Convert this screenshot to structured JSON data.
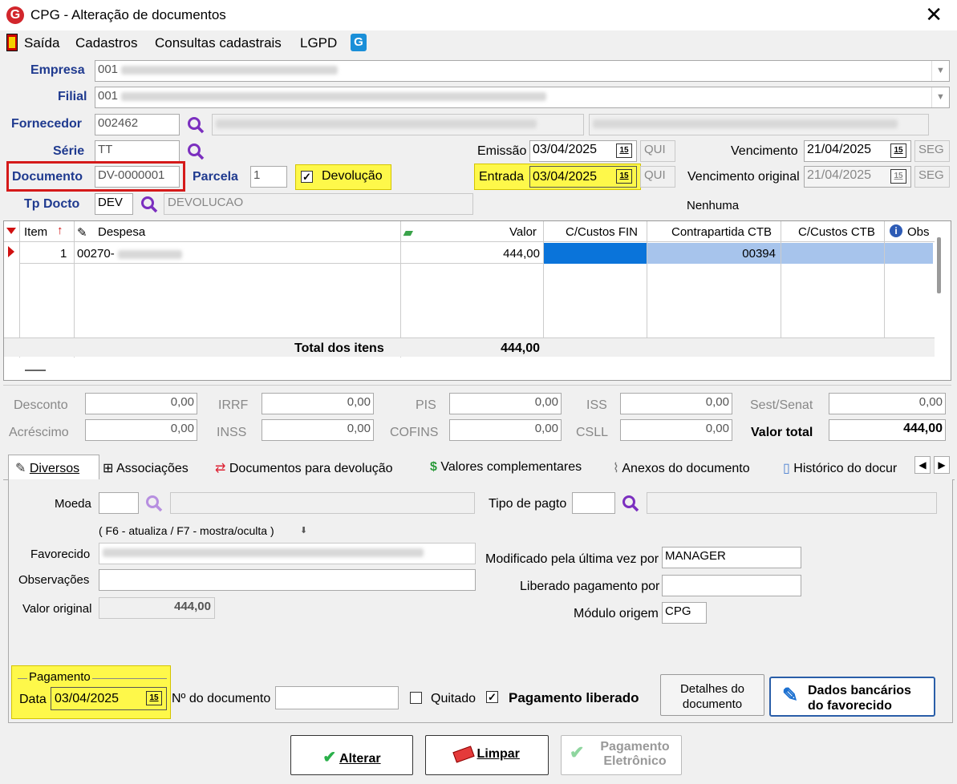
{
  "window": {
    "title": "CPG - Alteração de documentos",
    "logo": "G"
  },
  "menu": [
    "Saída",
    "Cadastros",
    "Consultas cadastrais",
    "LGPD"
  ],
  "form": {
    "empresa_label": "Empresa",
    "empresa_code": "001",
    "filial_label": "Filial",
    "filial_code": "001",
    "fornecedor_label": "Fornecedor",
    "fornecedor_code": "002462",
    "serie_label": "Série",
    "serie_value": "TT",
    "documento_label": "Documento",
    "documento_value": "DV-0000001",
    "parcela_label": "Parcela",
    "parcela_value": "1",
    "devolucao_label": "Devolução",
    "tpdocto_label": "Tp Docto",
    "tpdocto_code": "DEV",
    "tpdocto_desc": "DEVOLUCAO",
    "emissao_label": "Emissão",
    "emissao_value": "03/04/2025",
    "emissao_day": "QUI",
    "entrada_label": "Entrada",
    "entrada_value": "03/04/2025",
    "entrada_day": "QUI",
    "vencimento_label": "Vencimento",
    "vencimento_value": "21/04/2025",
    "vencimento_day": "SEG",
    "venc_orig_label": "Vencimento original",
    "venc_orig_value": "21/04/2025",
    "venc_orig_day": "SEG",
    "nenhuma": "Nenhuma",
    "cal_glyph": "15"
  },
  "grid": {
    "headers": {
      "item": "Item",
      "despesa": "Despesa",
      "valor": "Valor",
      "ccfin": "C/Custos FIN",
      "contra": "Contrapartida CTB",
      "ccctb": "C/Custos CTB",
      "obs": "Obs"
    },
    "row": {
      "item": "1",
      "despesa": "00270-",
      "valor": "444,00",
      "contra": "00394"
    },
    "total_label": "Total dos itens",
    "total_value": "444,00"
  },
  "taxes": {
    "desconto_label": "Desconto",
    "desconto": "0,00",
    "acrescimo_label": "Acréscimo",
    "acrescimo": "0,00",
    "irrf_label": "IRRF",
    "irrf": "0,00",
    "inss_label": "INSS",
    "inss": "0,00",
    "pis_label": "PIS",
    "pis": "0,00",
    "cofins_label": "COFINS",
    "cofins": "0,00",
    "iss_label": "ISS",
    "iss": "0,00",
    "csll_label": "CSLL",
    "csll": "0,00",
    "sest_label": "Sest/Senat",
    "sest": "0,00",
    "total_label": "Valor total",
    "total": "444,00"
  },
  "tabs": [
    "Diversos",
    "Associações",
    "Documentos para devolução",
    "Valores complementares",
    "Anexos do documento",
    "Histórico do docur"
  ],
  "diversos": {
    "moeda_label": "Moeda",
    "tipo_pagto_label": "Tipo de pagto",
    "hint": "( F6 - atualiza / F7 - mostra/oculta )",
    "favorecido_label": "Favorecido",
    "observacoes_label": "Observações",
    "valor_original_label": "Valor original",
    "valor_original": "444,00",
    "modificado_label": "Modificado pela última vez por",
    "modificado_value": "MANAGER",
    "liberado_label": "Liberado pagamento por",
    "modulo_label": "Módulo origem",
    "modulo_value": "CPG",
    "pagamento_group": "Pagamento",
    "data_label": "Data",
    "data_value": "03/04/2025",
    "ndoc_label": "Nº do documento",
    "quitado_label": "Quitado",
    "pag_liberado_label": "Pagamento liberado",
    "detalhes_line1": "Detalhes do",
    "detalhes_line2": "documento",
    "dados_line1": "Dados bancários",
    "dados_line2": "do favorecido"
  },
  "buttons": {
    "alterar": "Alterar",
    "limpar": "Limpar",
    "pag_line1": "Pagamento",
    "pag_line2": "Eletrônico"
  }
}
